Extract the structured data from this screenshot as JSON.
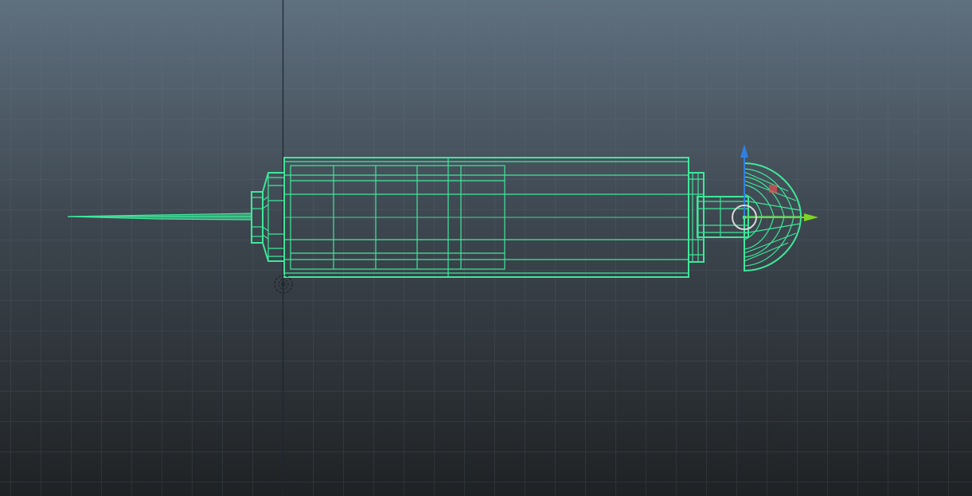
{
  "viewport": {
    "view": "side",
    "colors": {
      "bg_top": "#5f707f",
      "bg_bottom": "#1f2224",
      "grid": "#4c5761",
      "wire": "#3ee89a",
      "wire_dim": "#35c884",
      "axis_y": "#2f7fe0",
      "axis_z": "#7ed321",
      "axis_x": "#e05050"
    }
  }
}
